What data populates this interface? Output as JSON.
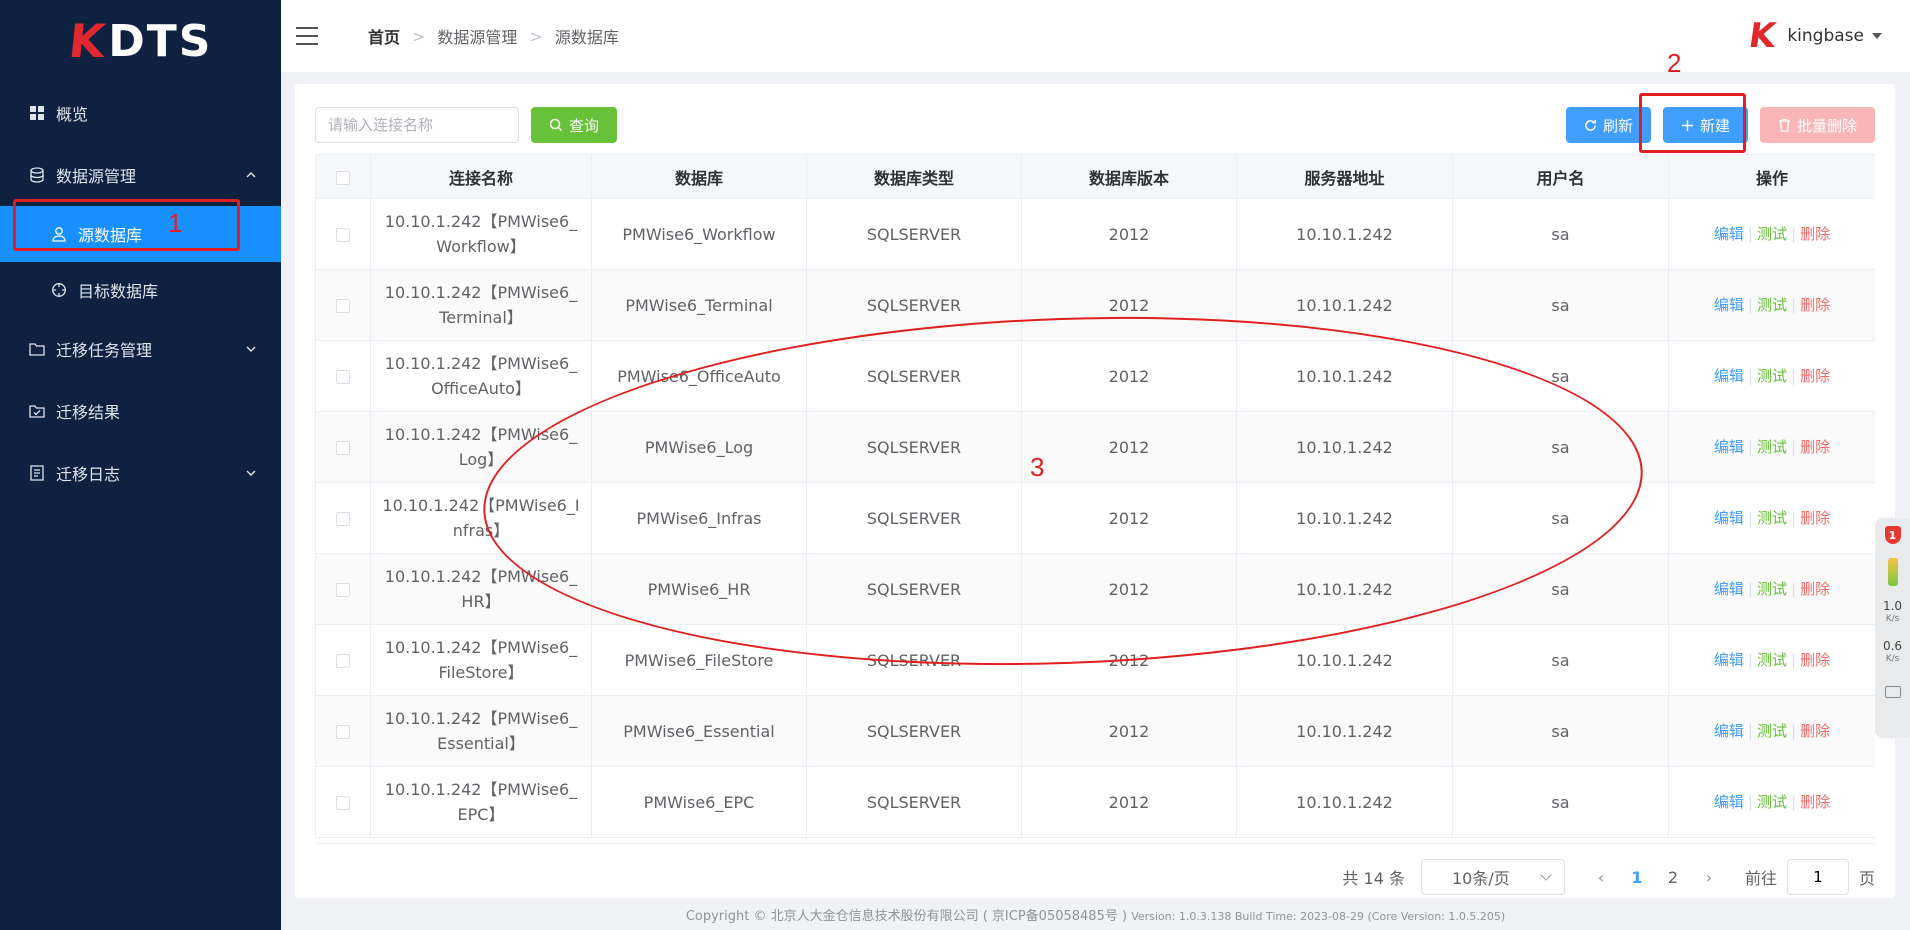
{
  "app": {
    "logo_k": "K",
    "logo_text": "DTS",
    "user_name": "kingbase"
  },
  "sidebar": {
    "overview": "概览",
    "datasource_mgmt": "数据源管理",
    "source_db": "源数据库",
    "target_db": "目标数据库",
    "task_mgmt": "迁移任务管理",
    "results": "迁移结果",
    "logs": "迁移日志"
  },
  "breadcrumb": [
    "首页",
    "数据源管理",
    "源数据库"
  ],
  "toolbar": {
    "search_placeholder": "请输入连接名称",
    "query_label": "查询",
    "refresh_label": "刷新",
    "new_label": "新建",
    "batch_delete_label": "批量删除"
  },
  "table": {
    "headers": [
      "连接名称",
      "数据库",
      "数据库类型",
      "数据库版本",
      "服务器地址",
      "用户名",
      "操作"
    ],
    "actions": {
      "edit": "编辑",
      "test": "测试",
      "delete": "删除"
    },
    "rows": [
      {
        "name": "10.10.1.242【PMWise6_Workflow】",
        "db": "PMWise6_Workflow",
        "type": "SQLSERVER",
        "version": "2012",
        "host": "10.10.1.242",
        "user": "sa"
      },
      {
        "name": "10.10.1.242【PMWise6_Terminal】",
        "db": "PMWise6_Terminal",
        "type": "SQLSERVER",
        "version": "2012",
        "host": "10.10.1.242",
        "user": "sa"
      },
      {
        "name": "10.10.1.242【PMWise6_OfficeAuto】",
        "db": "PMWise6_OfficeAuto",
        "type": "SQLSERVER",
        "version": "2012",
        "host": "10.10.1.242",
        "user": "sa"
      },
      {
        "name": "10.10.1.242【PMWise6_Log】",
        "db": "PMWise6_Log",
        "type": "SQLSERVER",
        "version": "2012",
        "host": "10.10.1.242",
        "user": "sa"
      },
      {
        "name": "10.10.1.242【PMWise6_Infras】",
        "db": "PMWise6_Infras",
        "type": "SQLSERVER",
        "version": "2012",
        "host": "10.10.1.242",
        "user": "sa"
      },
      {
        "name": "10.10.1.242【PMWise6_HR】",
        "db": "PMWise6_HR",
        "type": "SQLSERVER",
        "version": "2012",
        "host": "10.10.1.242",
        "user": "sa"
      },
      {
        "name": "10.10.1.242【PMWise6_FileStore】",
        "db": "PMWise6_FileStore",
        "type": "SQLSERVER",
        "version": "2012",
        "host": "10.10.1.242",
        "user": "sa"
      },
      {
        "name": "10.10.1.242【PMWise6_Essential】",
        "db": "PMWise6_Essential",
        "type": "SQLSERVER",
        "version": "2012",
        "host": "10.10.1.242",
        "user": "sa"
      },
      {
        "name": "10.10.1.242【PMWise6_EPC】",
        "db": "PMWise6_EPC",
        "type": "SQLSERVER",
        "version": "2012",
        "host": "10.10.1.242",
        "user": "sa"
      }
    ]
  },
  "pagination": {
    "total": "共 14 条",
    "page_size": "10条/页",
    "pages": [
      "1",
      "2"
    ],
    "current": "1",
    "goto_label": "前往",
    "goto_value": "1",
    "page_unit": "页"
  },
  "footer": {
    "copyright": "Copyright © 北京人大金仓信息技术股份有限公司 ( 京ICP备05058485号 )",
    "version": "Version: 1.0.3.138 Build Time: 2023-08-29 (Core Version: 1.0.5.205)"
  },
  "annotations": {
    "n1": "1",
    "n2": "2",
    "n3": "3"
  },
  "widget": {
    "badge": "1",
    "up": "1.0",
    "down": "0.6",
    "unit": "K/s"
  },
  "colors": {
    "sidebar_bg": "#0e2140",
    "active": "#1890ff",
    "primary": "#409eff",
    "success": "#67c23a",
    "danger": "#f56c6c",
    "annotation": "#e02020"
  }
}
